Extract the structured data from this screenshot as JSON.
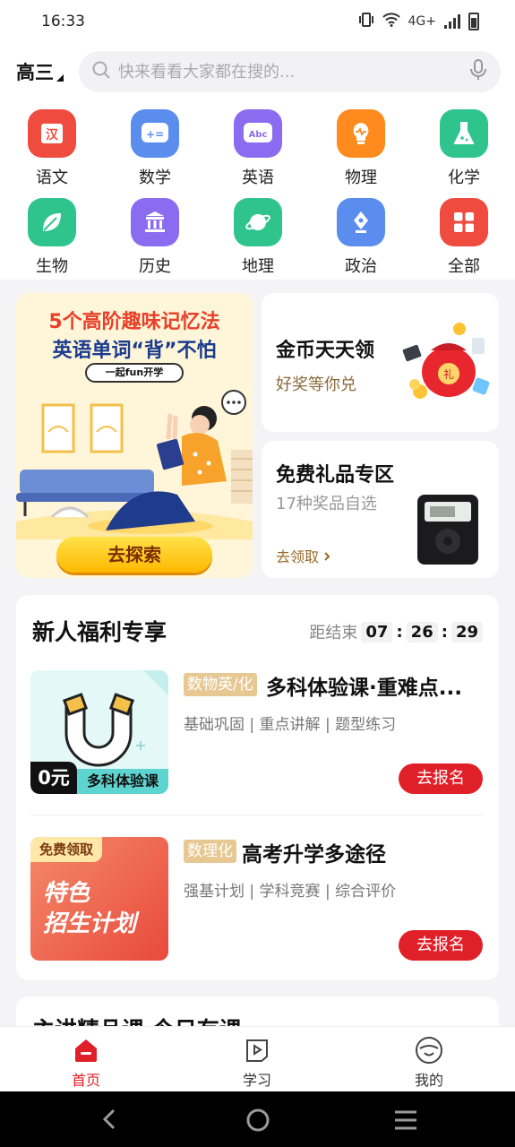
{
  "status": {
    "time": "16:33",
    "network": "4G+"
  },
  "header": {
    "grade": "高三",
    "search_placeholder": "快来看看大家都在搜的..."
  },
  "subjects": [
    {
      "label": "语文",
      "icon": "chinese-icon",
      "glyph": "汉",
      "color": "#ef4b3f"
    },
    {
      "label": "数学",
      "icon": "math-icon",
      "glyph": "+=",
      "color": "#5b8def"
    },
    {
      "label": "英语",
      "icon": "english-icon",
      "glyph": "Abc",
      "color": "#8b6cf0"
    },
    {
      "label": "物理",
      "icon": "physics-icon",
      "glyph": "",
      "color": "#ff8a1e"
    },
    {
      "label": "化学",
      "icon": "chemistry-icon",
      "glyph": "",
      "color": "#2fc48e"
    },
    {
      "label": "生物",
      "icon": "biology-icon",
      "glyph": "",
      "color": "#2fc48e"
    },
    {
      "label": "历史",
      "icon": "history-icon",
      "glyph": "",
      "color": "#8b6cf0"
    },
    {
      "label": "地理",
      "icon": "geography-icon",
      "glyph": "",
      "color": "#2fc48e"
    },
    {
      "label": "政治",
      "icon": "politics-icon",
      "glyph": "",
      "color": "#5b8def"
    },
    {
      "label": "全部",
      "icon": "all-icon",
      "glyph": "",
      "color": "#ef4b3f"
    }
  ],
  "banner": {
    "line1": "5个高阶趣味记忆法",
    "line2": "英语单词“背”不怕",
    "line3": "一起fun开学",
    "cta": "去探索"
  },
  "coins_card": {
    "title": "金币天天领",
    "subtitle": "好奖等你兑",
    "badge": "礼"
  },
  "gifts_card": {
    "title": "免费礼品专区",
    "subtitle": "17种奖品自选",
    "link": "去领取"
  },
  "welfare": {
    "title": "新人福利专享",
    "countdown_label": "距结束",
    "hours": "07",
    "minutes": "26",
    "seconds": "29",
    "courses": [
      {
        "tag": "数物英/化",
        "title": "多科体验课·重难点...",
        "meta": "基础巩固 | 重点讲解 | 题型练习",
        "price": "0元",
        "thumb_label": "多科体验课",
        "button": "去报名"
      },
      {
        "tag": "数理化",
        "title": "高考升学多途径",
        "meta": "强基计划 | 学科竞赛 | 综合评价",
        "thumb_badge": "免费领取",
        "thumb_line1": "特色",
        "thumb_line2": "招生计划",
        "button": "去报名"
      }
    ]
  },
  "next_section": {
    "title": "主讲精品课 今日有课"
  },
  "tabs": [
    {
      "label": "首页",
      "active": true
    },
    {
      "label": "学习",
      "active": false
    },
    {
      "label": "我的",
      "active": false
    }
  ]
}
